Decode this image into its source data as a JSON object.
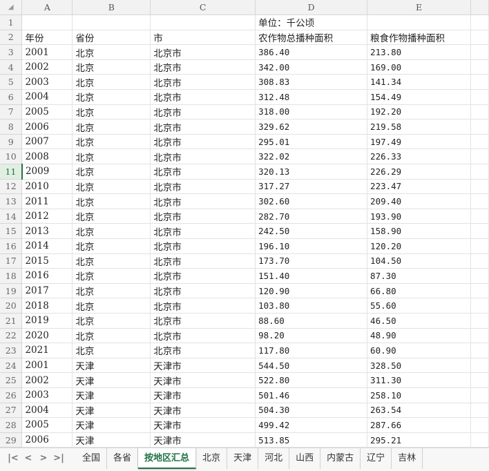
{
  "sheet": {
    "corner_glyph": "◢",
    "columns": [
      "A",
      "B",
      "C",
      "D",
      "E"
    ],
    "active_row": 11,
    "rows": [
      {
        "n": "1",
        "cells": [
          "",
          "",
          "",
          "单位：千公顷",
          ""
        ]
      },
      {
        "n": "2",
        "cells": [
          "年份",
          "省份",
          "市",
          "农作物总播种面积",
          "粮食作物播种面积"
        ]
      },
      {
        "n": "3",
        "cells": [
          "2001",
          "北京",
          "北京市",
          "386.40",
          "213.80"
        ]
      },
      {
        "n": "4",
        "cells": [
          "2002",
          "北京",
          "北京市",
          "342.00",
          "169.00"
        ]
      },
      {
        "n": "5",
        "cells": [
          "2003",
          "北京",
          "北京市",
          "308.83",
          "141.34"
        ]
      },
      {
        "n": "6",
        "cells": [
          "2004",
          "北京",
          "北京市",
          "312.48",
          "154.49"
        ]
      },
      {
        "n": "7",
        "cells": [
          "2005",
          "北京",
          "北京市",
          "318.00",
          "192.20"
        ]
      },
      {
        "n": "8",
        "cells": [
          "2006",
          "北京",
          "北京市",
          "329.62",
          "219.58"
        ]
      },
      {
        "n": "9",
        "cells": [
          "2007",
          "北京",
          "北京市",
          "295.01",
          "197.49"
        ]
      },
      {
        "n": "10",
        "cells": [
          "2008",
          "北京",
          "北京市",
          "322.02",
          "226.33"
        ]
      },
      {
        "n": "11",
        "cells": [
          "2009",
          "北京",
          "北京市",
          "320.13",
          "226.29"
        ]
      },
      {
        "n": "12",
        "cells": [
          "2010",
          "北京",
          "北京市",
          "317.27",
          "223.47"
        ]
      },
      {
        "n": "13",
        "cells": [
          "2011",
          "北京",
          "北京市",
          "302.60",
          "209.40"
        ]
      },
      {
        "n": "14",
        "cells": [
          "2012",
          "北京",
          "北京市",
          "282.70",
          "193.90"
        ]
      },
      {
        "n": "15",
        "cells": [
          "2013",
          "北京",
          "北京市",
          "242.50",
          "158.90"
        ]
      },
      {
        "n": "16",
        "cells": [
          "2014",
          "北京",
          "北京市",
          "196.10",
          "120.20"
        ]
      },
      {
        "n": "17",
        "cells": [
          "2015",
          "北京",
          "北京市",
          "173.70",
          "104.50"
        ]
      },
      {
        "n": "18",
        "cells": [
          "2016",
          "北京",
          "北京市",
          "151.40",
          "87.30"
        ]
      },
      {
        "n": "19",
        "cells": [
          "2017",
          "北京",
          "北京市",
          "120.90",
          "66.80"
        ]
      },
      {
        "n": "20",
        "cells": [
          "2018",
          "北京",
          "北京市",
          "103.80",
          "55.60"
        ]
      },
      {
        "n": "21",
        "cells": [
          "2019",
          "北京",
          "北京市",
          "88.60",
          "46.50"
        ]
      },
      {
        "n": "22",
        "cells": [
          "2020",
          "北京",
          "北京市",
          "98.20",
          "48.90"
        ]
      },
      {
        "n": "23",
        "cells": [
          "2021",
          "北京",
          "北京市",
          "117.80",
          "60.90"
        ]
      },
      {
        "n": "24",
        "cells": [
          "2001",
          "天津",
          "天津市",
          "544.50",
          "328.50"
        ]
      },
      {
        "n": "25",
        "cells": [
          "2002",
          "天津",
          "天津市",
          "522.80",
          "311.30"
        ]
      },
      {
        "n": "26",
        "cells": [
          "2003",
          "天津",
          "天津市",
          "501.46",
          "258.10"
        ]
      },
      {
        "n": "27",
        "cells": [
          "2004",
          "天津",
          "天津市",
          "504.30",
          "263.54"
        ]
      },
      {
        "n": "28",
        "cells": [
          "2005",
          "天津",
          "天津市",
          "499.42",
          "287.66"
        ]
      },
      {
        "n": "29",
        "cells": [
          "2006",
          "天津",
          "天津市",
          "513.85",
          "295.21"
        ]
      }
    ]
  },
  "tabbar": {
    "nav": {
      "first": "|<",
      "prev": "<",
      "next": ">",
      "last": ">|"
    },
    "tabs": [
      "全国",
      "各省",
      "按地区汇总",
      "北京",
      "天津",
      "河北",
      "山西",
      "内蒙古",
      "辽宁",
      "吉林"
    ],
    "active_tab": 2
  }
}
